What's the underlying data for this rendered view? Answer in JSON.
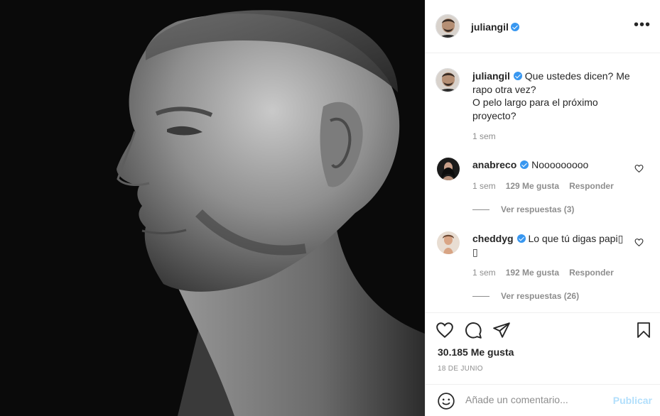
{
  "post": {
    "author": "juliangil",
    "verified": true,
    "more_icon": "more-dots-icon",
    "image_alt": "black and white side profile portrait"
  },
  "caption": {
    "username": "juliangil",
    "text": "Que ustedes dicen? Me rapo otra vez?\nO pelo largo para el próximo proyecto?",
    "time": "1 sem"
  },
  "comments": [
    {
      "username": "anabreco",
      "text": "Nooooooooo",
      "time": "1 sem",
      "likes": "129 Me gusta",
      "reply": "Responder",
      "view_replies": "Ver respuestas (3)"
    },
    {
      "username": "cheddyg",
      "text": "Lo que tú digas papi▯ ▯",
      "time": "1 sem",
      "likes": "192 Me gusta",
      "reply": "Responder",
      "view_replies": "Ver respuestas (26)"
    }
  ],
  "actions": {
    "like_icon": "heart-icon",
    "comment_icon": "comment-icon",
    "share_icon": "paper-plane-icon",
    "save_icon": "bookmark-icon"
  },
  "likes_count": "30.185 Me gusta",
  "date": "18 DE JUNIO",
  "comment_box": {
    "placeholder": "Añade un comentario...",
    "publish_label": "Publicar",
    "emoji_icon": "smiley-icon"
  },
  "colors": {
    "verified": "#3897f0",
    "publish_disabled": "#b2dffc",
    "secondary_text": "#8e8e8e"
  }
}
